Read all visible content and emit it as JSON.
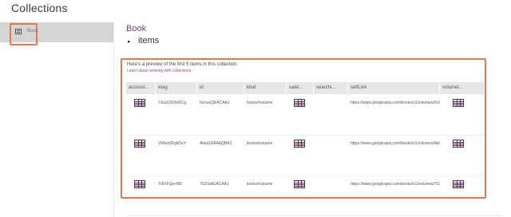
{
  "app": {
    "title": "Collections"
  },
  "sidebar": {
    "items": [
      {
        "label": "Book",
        "icon": "table-icon",
        "selected": true
      }
    ]
  },
  "main": {
    "title": "Book",
    "tree": {
      "toggle": "▸",
      "label": "items"
    },
    "preview": {
      "heading": "Here's a preview of the first 5 items in this collection",
      "link": "Learn about working with collections.",
      "columns": [
        "accessI...",
        "etag",
        "id",
        "kind",
        "salel...",
        "searchi...",
        "selfLink",
        "volumel..."
      ],
      "rows": [
        {
          "etag": "7JuaQ3OkWCg",
          "id": "hUxuvQEACAAJ",
          "kind": "books#volume",
          "selfLink": "https://www.googleapis.com/books/v1/volumes/hUxuvQEACAAJ"
        },
        {
          "etag": "VWwz5FgkDuY",
          "id": "AwuGDAAAQBAJ",
          "kind": "books#volume",
          "selfLink": "https://www.googleapis.com/books/v1/volumes/AwuGDAAAQBAJ"
        },
        {
          "etag": "Tr8XFQe+BE",
          "id": "7G2IuAEACAAJ",
          "kind": "books#volume",
          "selfLink": "https://www.googleapis.com/books/v1/volumes/7G2IuAEACAAJ"
        }
      ]
    }
  },
  "colors": {
    "accent": "#7a3f7a",
    "highlight": "#e07a4f",
    "icon": "#5b2a5b"
  }
}
